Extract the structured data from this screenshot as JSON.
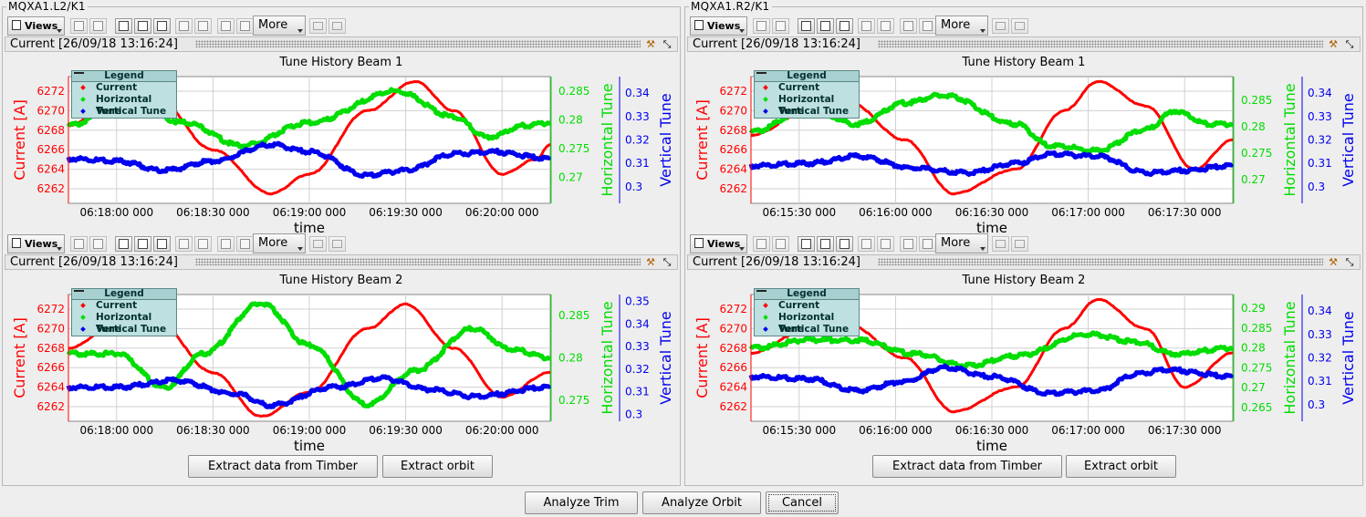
{
  "toolbar": {
    "views_label": "Views",
    "more_label": "More"
  },
  "colors": {
    "current": "#ff0000",
    "horizontal": "#00dd00",
    "vertical": "#0000ee"
  },
  "buttons": {
    "extract_timber": "Extract data from Timber",
    "extract_orbit": "Extract orbit",
    "analyze_trim": "Analyze Trim",
    "analyze_orbit": "Analyze Orbit",
    "cancel": "Cancel"
  },
  "legend": {
    "title": "Legend",
    "items": [
      "Current",
      "Horizontal Tune",
      "Vertical Tune"
    ]
  },
  "axis_titles": {
    "current": "Current [A]",
    "horizontal": "Horizontal Tune",
    "vertical": "Vertical Tune",
    "x": "time"
  },
  "groups": [
    {
      "title": "MQXA1.L2/K1",
      "panels": [
        {
          "status": "Current  [26/09/18 13:16:24]",
          "title": "Tune History Beam 1"
        },
        {
          "status": "Current  [26/09/18 13:16:24]",
          "title": "Tune History Beam 2"
        }
      ]
    },
    {
      "title": "MQXA1.R2/K1",
      "panels": [
        {
          "status": "Current  [26/09/18 13:16:24]",
          "title": "Tune History Beam 1"
        },
        {
          "status": "Current  [26/09/18 13:16:24]",
          "title": "Tune History Beam 2"
        }
      ]
    }
  ],
  "chart_data": [
    {
      "type": "line",
      "title": "Tune History Beam 1",
      "xlabel": "time",
      "x_ticks": [
        "06:18:00 000",
        "06:18:30 000",
        "06:19:00 000",
        "06:19:30 000",
        "06:20:00 000"
      ],
      "y_left": {
        "label": "Current [A]",
        "ticks": [
          6262,
          6264,
          6266,
          6268,
          6270,
          6272
        ],
        "ylim": [
          6260.5,
          6273.5
        ]
      },
      "y_right1": {
        "label": "Horizontal Tune",
        "ticks": [
          0.27,
          0.275,
          0.28,
          0.285
        ],
        "ylim": [
          0.2655,
          0.2875
        ]
      },
      "y_right2": {
        "label": "Vertical Tune",
        "ticks": [
          0.3,
          0.31,
          0.32,
          0.33,
          0.34
        ],
        "ylim": [
          0.293,
          0.347
        ]
      },
      "series": [
        {
          "name": "Current",
          "points": [
            [
              0,
              6268.5
            ],
            [
              0.1,
              6271
            ],
            [
              0.18,
              6271.5
            ],
            [
              0.3,
              6266
            ],
            [
              0.42,
              6261.5
            ],
            [
              0.5,
              6263.5
            ],
            [
              0.62,
              6270
            ],
            [
              0.72,
              6273
            ],
            [
              0.8,
              6270
            ],
            [
              0.9,
              6263.5
            ],
            [
              0.97,
              6265
            ],
            [
              1,
              6266.5
            ]
          ]
        },
        {
          "name": "Horizontal Tune",
          "points": [
            [
              0,
              0.279
            ],
            [
              0.12,
              0.2835
            ],
            [
              0.24,
              0.2795
            ],
            [
              0.36,
              0.2755
            ],
            [
              0.5,
              0.2795
            ],
            [
              0.68,
              0.285
            ],
            [
              0.8,
              0.2805
            ],
            [
              0.87,
              0.277
            ],
            [
              0.95,
              0.279
            ],
            [
              1,
              0.2795
            ]
          ]
        },
        {
          "name": "Vertical Tune",
          "points": [
            [
              0,
              0.312
            ],
            [
              0.1,
              0.311
            ],
            [
              0.2,
              0.307
            ],
            [
              0.3,
              0.311
            ],
            [
              0.42,
              0.318
            ],
            [
              0.5,
              0.315
            ],
            [
              0.62,
              0.305
            ],
            [
              0.7,
              0.307
            ],
            [
              0.8,
              0.314
            ],
            [
              0.88,
              0.315
            ],
            [
              1,
              0.312
            ]
          ]
        }
      ]
    },
    {
      "type": "line",
      "title": "Tune History Beam 2",
      "xlabel": "time",
      "x_ticks": [
        "06:18:00 000",
        "06:18:30 000",
        "06:19:00 000",
        "06:19:30 000",
        "06:20:00 000"
      ],
      "y_left": {
        "label": "Current [A]",
        "ticks": [
          6262,
          6264,
          6266,
          6268,
          6270,
          6272
        ],
        "ylim": [
          6260.5,
          6273.5
        ]
      },
      "y_right1": {
        "label": "Horizontal Tune",
        "ticks": [
          0.275,
          0.28,
          0.285
        ],
        "ylim": [
          0.2725,
          0.2875
        ]
      },
      "y_right2": {
        "label": "Vertical Tune",
        "ticks": [
          0.3,
          0.31,
          0.32,
          0.33,
          0.34,
          0.35
        ],
        "ylim": [
          0.297,
          0.353
        ]
      },
      "series": [
        {
          "name": "Current",
          "points": [
            [
              0,
              6268
            ],
            [
              0.1,
              6270.5
            ],
            [
              0.18,
              6271
            ],
            [
              0.3,
              6265.5
            ],
            [
              0.4,
              6261
            ],
            [
              0.5,
              6263.5
            ],
            [
              0.62,
              6270
            ],
            [
              0.7,
              6272.5
            ],
            [
              0.8,
              6268
            ],
            [
              0.9,
              6263
            ],
            [
              1,
              6265.5
            ]
          ]
        },
        {
          "name": "Horizontal Tune",
          "points": [
            [
              0,
              0.2805
            ],
            [
              0.1,
              0.2805
            ],
            [
              0.2,
              0.2765
            ],
            [
              0.28,
              0.2805
            ],
            [
              0.4,
              0.2865
            ],
            [
              0.5,
              0.2815
            ],
            [
              0.62,
              0.2745
            ],
            [
              0.72,
              0.2785
            ],
            [
              0.84,
              0.2835
            ],
            [
              0.92,
              0.281
            ],
            [
              1,
              0.28
            ]
          ]
        },
        {
          "name": "Vertical Tune",
          "points": [
            [
              0,
              0.312
            ],
            [
              0.1,
              0.312
            ],
            [
              0.22,
              0.315
            ],
            [
              0.35,
              0.309
            ],
            [
              0.42,
              0.304
            ],
            [
              0.55,
              0.312
            ],
            [
              0.65,
              0.316
            ],
            [
              0.75,
              0.311
            ],
            [
              0.84,
              0.308
            ],
            [
              1,
              0.312
            ]
          ]
        }
      ]
    },
    {
      "type": "line",
      "title": "Tune History Beam 1",
      "xlabel": "time",
      "x_ticks": [
        "06:15:30 000",
        "06:16:00 000",
        "06:16:30 000",
        "06:17:00 000",
        "06:17:30 000"
      ],
      "y_left": {
        "label": "Current [A]",
        "ticks": [
          6262,
          6264,
          6266,
          6268,
          6270,
          6272
        ],
        "ylim": [
          6260.5,
          6273.5
        ]
      },
      "y_right1": {
        "label": "Horizontal Tune",
        "ticks": [
          0.27,
          0.275,
          0.28,
          0.285
        ],
        "ylim": [
          0.2655,
          0.2895
        ]
      },
      "y_right2": {
        "label": "Vertical Tune",
        "ticks": [
          0.3,
          0.31,
          0.32,
          0.33,
          0.34
        ],
        "ylim": [
          0.293,
          0.347
        ]
      },
      "series": [
        {
          "name": "Current",
          "points": [
            [
              0,
              6267.5
            ],
            [
              0.12,
              6270
            ],
            [
              0.2,
              6271
            ],
            [
              0.32,
              6267
            ],
            [
              0.42,
              6261.5
            ],
            [
              0.55,
              6264
            ],
            [
              0.65,
              6270
            ],
            [
              0.72,
              6273
            ],
            [
              0.82,
              6270.5
            ],
            [
              0.92,
              6264
            ],
            [
              1,
              6267
            ]
          ]
        },
        {
          "name": "Horizontal Tune",
          "points": [
            [
              0,
              0.279
            ],
            [
              0.12,
              0.2835
            ],
            [
              0.22,
              0.2805
            ],
            [
              0.32,
              0.2845
            ],
            [
              0.4,
              0.286
            ],
            [
              0.55,
              0.2805
            ],
            [
              0.62,
              0.2765
            ],
            [
              0.72,
              0.2755
            ],
            [
              0.82,
              0.2795
            ],
            [
              0.88,
              0.283
            ],
            [
              0.95,
              0.2805
            ],
            [
              1,
              0.2805
            ]
          ]
        },
        {
          "name": "Vertical Tune",
          "points": [
            [
              0,
              0.309
            ],
            [
              0.12,
              0.31
            ],
            [
              0.22,
              0.313
            ],
            [
              0.34,
              0.308
            ],
            [
              0.45,
              0.306
            ],
            [
              0.55,
              0.31
            ],
            [
              0.62,
              0.314
            ],
            [
              0.72,
              0.313
            ],
            [
              0.82,
              0.306
            ],
            [
              0.9,
              0.307
            ],
            [
              1,
              0.309
            ]
          ]
        }
      ]
    },
    {
      "type": "line",
      "title": "Tune History Beam 2",
      "xlabel": "time",
      "x_ticks": [
        "06:15:30 000",
        "06:16:00 000",
        "06:16:30 000",
        "06:17:00 000",
        "06:17:30 000"
      ],
      "y_left": {
        "label": "Current [A]",
        "ticks": [
          6262,
          6264,
          6266,
          6268,
          6270,
          6272
        ],
        "ylim": [
          6260.5,
          6273.5
        ]
      },
      "y_right1": {
        "label": "Horizontal Tune",
        "ticks": [
          0.265,
          0.27,
          0.275,
          0.28,
          0.285,
          0.29
        ],
        "ylim": [
          0.2615,
          0.2935
        ]
      },
      "y_right2": {
        "label": "Vertical Tune",
        "ticks": [
          0.3,
          0.31,
          0.32,
          0.33,
          0.34
        ],
        "ylim": [
          0.293,
          0.347
        ]
      },
      "series": [
        {
          "name": "Current",
          "points": [
            [
              0,
              6267.5
            ],
            [
              0.12,
              6270
            ],
            [
              0.2,
              6270.5
            ],
            [
              0.32,
              6267
            ],
            [
              0.42,
              6261.5
            ],
            [
              0.55,
              6264
            ],
            [
              0.65,
              6270
            ],
            [
              0.72,
              6273
            ],
            [
              0.82,
              6270
            ],
            [
              0.9,
              6264
            ],
            [
              1,
              6267.5
            ]
          ]
        },
        {
          "name": "Horizontal Tune",
          "points": [
            [
              0,
              0.28
            ],
            [
              0.12,
              0.282
            ],
            [
              0.22,
              0.282
            ],
            [
              0.34,
              0.2785
            ],
            [
              0.45,
              0.2755
            ],
            [
              0.55,
              0.278
            ],
            [
              0.7,
              0.2835
            ],
            [
              0.8,
              0.2815
            ],
            [
              0.88,
              0.2785
            ],
            [
              1,
              0.28
            ]
          ]
        },
        {
          "name": "Vertical Tune",
          "points": [
            [
              0,
              0.312
            ],
            [
              0.12,
              0.311
            ],
            [
              0.22,
              0.306
            ],
            [
              0.32,
              0.31
            ],
            [
              0.4,
              0.316
            ],
            [
              0.5,
              0.312
            ],
            [
              0.62,
              0.305
            ],
            [
              0.72,
              0.306
            ],
            [
              0.8,
              0.313
            ],
            [
              0.86,
              0.315
            ],
            [
              1,
              0.312
            ]
          ]
        }
      ]
    }
  ]
}
